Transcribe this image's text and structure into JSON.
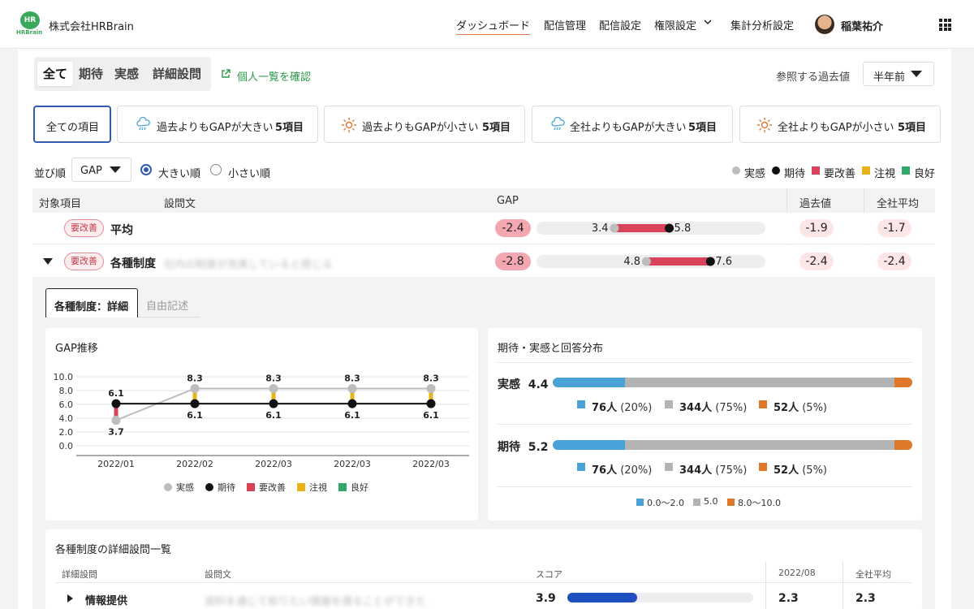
{
  "header": {
    "logo_text": "HR",
    "logo_sub": "HRBrain",
    "company": "株式会社HRBrain",
    "nav": [
      "ダッシュボード",
      "配信管理",
      "配信設定",
      "権限設定",
      "集計分析設定"
    ],
    "user_name": "稲葉祐介"
  },
  "tabs": [
    "全て",
    "期待",
    "実感",
    "詳細設問"
  ],
  "individual_link": "個人一覧を確認",
  "ref_label": "参照する過去値",
  "ref_value": "半年前",
  "filters": [
    {
      "label": "全ての項目",
      "count": ""
    },
    {
      "label": "過去よりもGAPが大きい",
      "count": "5項目"
    },
    {
      "label": "過去よりもGAPが小さい",
      "count": "5項目"
    },
    {
      "label": "全社よりもGAPが大きい",
      "count": "5項目"
    },
    {
      "label": "全社よりもGAPが小さい",
      "count": "5項目"
    }
  ],
  "sort": {
    "label": "並び順",
    "value": "GAP",
    "opt_desc": "大きい順",
    "opt_asc": "小さい順"
  },
  "legend": [
    "実感",
    "期待",
    "要改善",
    "注視",
    "良好"
  ],
  "colors": {
    "actual": "#bdbdbd",
    "expect": "#111111",
    "bad": "#d9435a",
    "watch": "#e8b21a",
    "good": "#2fa86a",
    "low": "#4aa3d8",
    "mid": "#b3b3b3",
    "high": "#e0782a"
  },
  "table": {
    "headers": [
      "対象項目",
      "設問文",
      "GAP",
      "過去値",
      "全社平均"
    ],
    "rows": [
      {
        "badge": "要改善",
        "title": "平均",
        "desc": "",
        "gap": "-2.4",
        "actual": "3.4",
        "expect": "5.8",
        "actual_v": 3.4,
        "expect_v": 5.8,
        "past": "-1.9",
        "avg": "-1.7"
      },
      {
        "badge": "要改善",
        "title": "各種制度",
        "desc": "社内の制度が充実していると感じる",
        "gap": "-2.8",
        "actual": "4.8",
        "expect": "7.6",
        "actual_v": 4.8,
        "expect_v": 7.6,
        "past": "-2.4",
        "avg": "-2.4"
      }
    ]
  },
  "detail": {
    "tabs": [
      "各種制度：詳細",
      "自由記述"
    ],
    "gap_title": "GAP推移",
    "dist_title": "期待・実感と回答分布",
    "dist": [
      {
        "label": "実感",
        "value": "4.4",
        "segments": [
          {
            "pct": 20,
            "count": "76人",
            "pct_text": "(20%)"
          },
          {
            "pct": 75,
            "count": "344人",
            "pct_text": "(75%)"
          },
          {
            "pct": 5,
            "count": "52人",
            "pct_text": "(5%)"
          }
        ]
      },
      {
        "label": "期待",
        "value": "5.2",
        "segments": [
          {
            "pct": 20,
            "count": "76人",
            "pct_text": "(20%)"
          },
          {
            "pct": 75,
            "count": "344人",
            "pct_text": "(75%)"
          },
          {
            "pct": 5,
            "count": "52人",
            "pct_text": "(5%)"
          }
        ]
      }
    ],
    "dist_legend": [
      "0.0〜2.0",
      "5.0",
      "8.0〜10.0"
    ],
    "list_title": "各種制度の詳細設問一覧",
    "list_headers": [
      "詳細設問",
      "設問文",
      "スコア",
      "2022/08",
      "全社平均"
    ],
    "list_rows": [
      {
        "title": "情報提供",
        "desc": "資料を通じて知りたい情報を得ることができた",
        "score": "3.9",
        "score_v": 3.9,
        "past": "2.3",
        "avg": "2.3"
      }
    ]
  },
  "chart_data": {
    "type": "line",
    "title": "GAP推移",
    "categories": [
      "2022/01",
      "2022/02",
      "2022/03",
      "2022/03",
      "2022/03"
    ],
    "series": [
      {
        "name": "実感",
        "values": [
          3.7,
          8.3,
          8.3,
          8.3,
          8.3
        ]
      },
      {
        "name": "期待",
        "values": [
          6.1,
          6.1,
          6.1,
          6.1,
          6.1
        ]
      }
    ],
    "gap_status": [
      "要改善",
      "注視",
      "注視",
      "注視",
      "注視"
    ],
    "yticks": [
      "10.0",
      "8.0",
      "6.0",
      "4.0",
      "2.0",
      "0.0"
    ],
    "ylim": [
      0,
      10
    ],
    "legend": [
      "実感",
      "期待",
      "要改善",
      "注視",
      "良好"
    ],
    "grid": true,
    "legend_position": "bottom"
  }
}
